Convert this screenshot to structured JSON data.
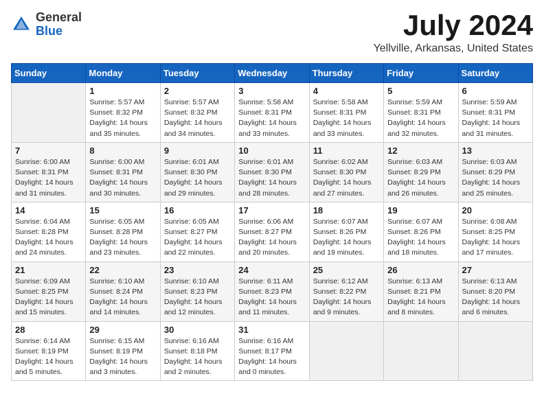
{
  "header": {
    "logo_general": "General",
    "logo_blue": "Blue",
    "month": "July 2024",
    "location": "Yellville, Arkansas, United States"
  },
  "calendar": {
    "days_of_week": [
      "Sunday",
      "Monday",
      "Tuesday",
      "Wednesday",
      "Thursday",
      "Friday",
      "Saturday"
    ],
    "weeks": [
      [
        {
          "day": "",
          "sunrise": "",
          "sunset": "",
          "daylight": ""
        },
        {
          "day": "1",
          "sunrise": "Sunrise: 5:57 AM",
          "sunset": "Sunset: 8:32 PM",
          "daylight": "Daylight: 14 hours and 35 minutes."
        },
        {
          "day": "2",
          "sunrise": "Sunrise: 5:57 AM",
          "sunset": "Sunset: 8:32 PM",
          "daylight": "Daylight: 14 hours and 34 minutes."
        },
        {
          "day": "3",
          "sunrise": "Sunrise: 5:58 AM",
          "sunset": "Sunset: 8:31 PM",
          "daylight": "Daylight: 14 hours and 33 minutes."
        },
        {
          "day": "4",
          "sunrise": "Sunrise: 5:58 AM",
          "sunset": "Sunset: 8:31 PM",
          "daylight": "Daylight: 14 hours and 33 minutes."
        },
        {
          "day": "5",
          "sunrise": "Sunrise: 5:59 AM",
          "sunset": "Sunset: 8:31 PM",
          "daylight": "Daylight: 14 hours and 32 minutes."
        },
        {
          "day": "6",
          "sunrise": "Sunrise: 5:59 AM",
          "sunset": "Sunset: 8:31 PM",
          "daylight": "Daylight: 14 hours and 31 minutes."
        }
      ],
      [
        {
          "day": "7",
          "sunrise": "Sunrise: 6:00 AM",
          "sunset": "Sunset: 8:31 PM",
          "daylight": "Daylight: 14 hours and 31 minutes."
        },
        {
          "day": "8",
          "sunrise": "Sunrise: 6:00 AM",
          "sunset": "Sunset: 8:31 PM",
          "daylight": "Daylight: 14 hours and 30 minutes."
        },
        {
          "day": "9",
          "sunrise": "Sunrise: 6:01 AM",
          "sunset": "Sunset: 8:30 PM",
          "daylight": "Daylight: 14 hours and 29 minutes."
        },
        {
          "day": "10",
          "sunrise": "Sunrise: 6:01 AM",
          "sunset": "Sunset: 8:30 PM",
          "daylight": "Daylight: 14 hours and 28 minutes."
        },
        {
          "day": "11",
          "sunrise": "Sunrise: 6:02 AM",
          "sunset": "Sunset: 8:30 PM",
          "daylight": "Daylight: 14 hours and 27 minutes."
        },
        {
          "day": "12",
          "sunrise": "Sunrise: 6:03 AM",
          "sunset": "Sunset: 8:29 PM",
          "daylight": "Daylight: 14 hours and 26 minutes."
        },
        {
          "day": "13",
          "sunrise": "Sunrise: 6:03 AM",
          "sunset": "Sunset: 8:29 PM",
          "daylight": "Daylight: 14 hours and 25 minutes."
        }
      ],
      [
        {
          "day": "14",
          "sunrise": "Sunrise: 6:04 AM",
          "sunset": "Sunset: 8:28 PM",
          "daylight": "Daylight: 14 hours and 24 minutes."
        },
        {
          "day": "15",
          "sunrise": "Sunrise: 6:05 AM",
          "sunset": "Sunset: 8:28 PM",
          "daylight": "Daylight: 14 hours and 23 minutes."
        },
        {
          "day": "16",
          "sunrise": "Sunrise: 6:05 AM",
          "sunset": "Sunset: 8:27 PM",
          "daylight": "Daylight: 14 hours and 22 minutes."
        },
        {
          "day": "17",
          "sunrise": "Sunrise: 6:06 AM",
          "sunset": "Sunset: 8:27 PM",
          "daylight": "Daylight: 14 hours and 20 minutes."
        },
        {
          "day": "18",
          "sunrise": "Sunrise: 6:07 AM",
          "sunset": "Sunset: 8:26 PM",
          "daylight": "Daylight: 14 hours and 19 minutes."
        },
        {
          "day": "19",
          "sunrise": "Sunrise: 6:07 AM",
          "sunset": "Sunset: 8:26 PM",
          "daylight": "Daylight: 14 hours and 18 minutes."
        },
        {
          "day": "20",
          "sunrise": "Sunrise: 6:08 AM",
          "sunset": "Sunset: 8:25 PM",
          "daylight": "Daylight: 14 hours and 17 minutes."
        }
      ],
      [
        {
          "day": "21",
          "sunrise": "Sunrise: 6:09 AM",
          "sunset": "Sunset: 8:25 PM",
          "daylight": "Daylight: 14 hours and 15 minutes."
        },
        {
          "day": "22",
          "sunrise": "Sunrise: 6:10 AM",
          "sunset": "Sunset: 8:24 PM",
          "daylight": "Daylight: 14 hours and 14 minutes."
        },
        {
          "day": "23",
          "sunrise": "Sunrise: 6:10 AM",
          "sunset": "Sunset: 8:23 PM",
          "daylight": "Daylight: 14 hours and 12 minutes."
        },
        {
          "day": "24",
          "sunrise": "Sunrise: 6:11 AM",
          "sunset": "Sunset: 8:23 PM",
          "daylight": "Daylight: 14 hours and 11 minutes."
        },
        {
          "day": "25",
          "sunrise": "Sunrise: 6:12 AM",
          "sunset": "Sunset: 8:22 PM",
          "daylight": "Daylight: 14 hours and 9 minutes."
        },
        {
          "day": "26",
          "sunrise": "Sunrise: 6:13 AM",
          "sunset": "Sunset: 8:21 PM",
          "daylight": "Daylight: 14 hours and 8 minutes."
        },
        {
          "day": "27",
          "sunrise": "Sunrise: 6:13 AM",
          "sunset": "Sunset: 8:20 PM",
          "daylight": "Daylight: 14 hours and 6 minutes."
        }
      ],
      [
        {
          "day": "28",
          "sunrise": "Sunrise: 6:14 AM",
          "sunset": "Sunset: 8:19 PM",
          "daylight": "Daylight: 14 hours and 5 minutes."
        },
        {
          "day": "29",
          "sunrise": "Sunrise: 6:15 AM",
          "sunset": "Sunset: 8:19 PM",
          "daylight": "Daylight: 14 hours and 3 minutes."
        },
        {
          "day": "30",
          "sunrise": "Sunrise: 6:16 AM",
          "sunset": "Sunset: 8:18 PM",
          "daylight": "Daylight: 14 hours and 2 minutes."
        },
        {
          "day": "31",
          "sunrise": "Sunrise: 6:16 AM",
          "sunset": "Sunset: 8:17 PM",
          "daylight": "Daylight: 14 hours and 0 minutes."
        },
        {
          "day": "",
          "sunrise": "",
          "sunset": "",
          "daylight": ""
        },
        {
          "day": "",
          "sunrise": "",
          "sunset": "",
          "daylight": ""
        },
        {
          "day": "",
          "sunrise": "",
          "sunset": "",
          "daylight": ""
        }
      ]
    ]
  }
}
